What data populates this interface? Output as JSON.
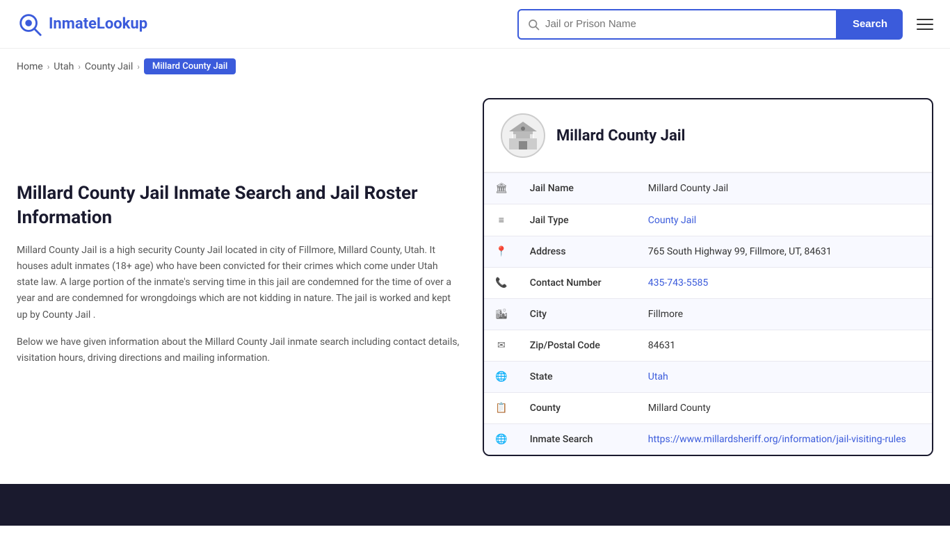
{
  "header": {
    "logo_text_prefix": "Inmate",
    "logo_text_suffix": "Lookup",
    "search_placeholder": "Jail or Prison Name",
    "search_button_label": "Search",
    "menu_aria": "Open menu"
  },
  "breadcrumb": {
    "items": [
      {
        "label": "Home",
        "href": "#"
      },
      {
        "label": "Utah",
        "href": "#"
      },
      {
        "label": "County Jail",
        "href": "#"
      }
    ],
    "active": "Millard County Jail"
  },
  "left": {
    "heading": "Millard County Jail Inmate Search and Jail Roster Information",
    "paragraph1": "Millard County Jail is a high security County Jail located in city of Fillmore, Millard County, Utah. It houses adult inmates (18+ age) who have been convicted for their crimes which come under Utah state law. A large portion of the inmate's serving time in this jail are condemned for the time of over a year and are condemned for wrongdoings which are not kidding in nature. The jail is worked and kept up by County Jail .",
    "paragraph2": "Below we have given information about the Millard County Jail inmate search including contact details, visitation hours, driving directions and mailing information."
  },
  "card": {
    "title": "Millard County Jail",
    "rows": [
      {
        "icon": "🏛",
        "label": "Jail Name",
        "value": "Millard County Jail",
        "link": null
      },
      {
        "icon": "≡",
        "label": "Jail Type",
        "value": "County Jail",
        "link": "#"
      },
      {
        "icon": "📍",
        "label": "Address",
        "value": "765 South Highway 99, Fillmore, UT, 84631",
        "link": null
      },
      {
        "icon": "📞",
        "label": "Contact Number",
        "value": "435-743-5585",
        "link": "tel:435-743-5585"
      },
      {
        "icon": "🏙",
        "label": "City",
        "value": "Fillmore",
        "link": null
      },
      {
        "icon": "✉",
        "label": "Zip/Postal Code",
        "value": "84631",
        "link": null
      },
      {
        "icon": "🌐",
        "label": "State",
        "value": "Utah",
        "link": "#"
      },
      {
        "icon": "📋",
        "label": "County",
        "value": "Millard County",
        "link": null
      },
      {
        "icon": "🌐",
        "label": "Inmate Search",
        "value": "https://www.millardsheriff.org/information/jail-visiting-rules",
        "link": "https://www.millardsheriff.org/information/jail-visiting-rules"
      }
    ]
  }
}
